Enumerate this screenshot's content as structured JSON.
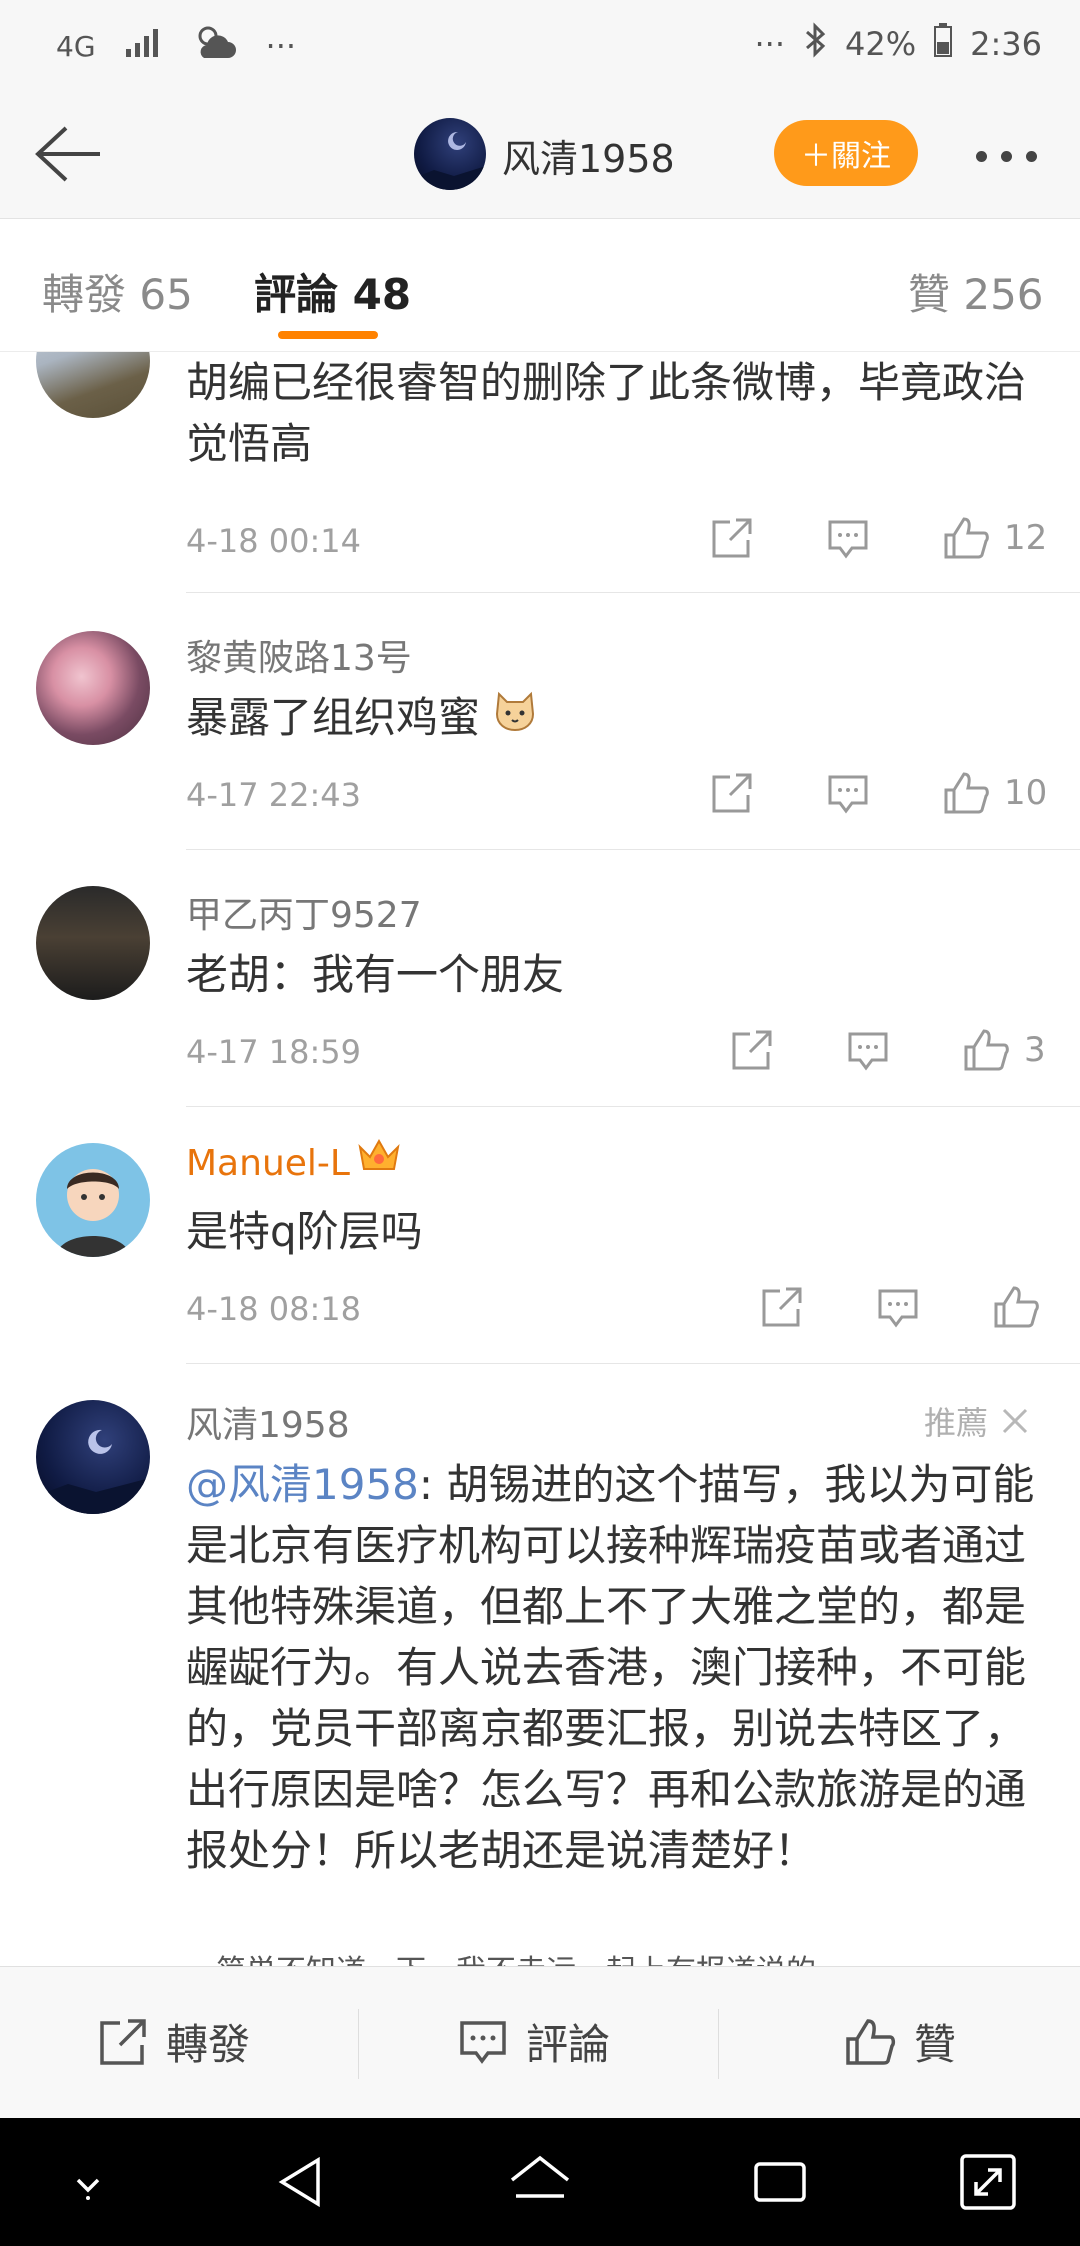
{
  "status": {
    "network": "4G",
    "battery": "42%",
    "time": "2:36",
    "dots": "···"
  },
  "header": {
    "title": "风清1958",
    "follow_label": "＋關注"
  },
  "tabs": [
    {
      "label": "轉發 65"
    },
    {
      "label": "評論 48"
    },
    {
      "label": "贊 256"
    }
  ],
  "comments": [
    {
      "name": "",
      "text": "胡编已经很睿智的删除了此条微博，毕竟政治觉悟高",
      "time": "4-18 00:14",
      "likes": "12"
    },
    {
      "name": "黎黄陂路13号",
      "text": "暴露了组织鸡蜜",
      "time": "4-17 22:43",
      "likes": "10"
    },
    {
      "name": "甲乙丙丁9527",
      "text": "老胡：我有一个朋友",
      "time": "4-17 18:59",
      "likes": "3"
    },
    {
      "name": "Manuel-L",
      "text": "是特q阶层吗",
      "time": "4-18 08:18",
      "likes": ""
    },
    {
      "name": "风清1958",
      "recommend": "推薦",
      "mention": "@风清1958",
      "text": ": 胡锡进的这个描写，我以为可能是北京有医疗机构可以接种辉瑞疫苗或者通过其他特殊渠道，但都上不了大雅之堂的，都是龌龊行为。有人说去香港，澳门接种，不可能的，党员干部离京都要汇报，别说去特区了，出行原因是啥？怎么写？再和公款旅游是的通报处分！所以老胡还是说清楚好！",
      "cut_line": "…简単不知道…下…我不走运…起上有报道说的"
    }
  ],
  "bottom": {
    "repost": "轉發",
    "comment": "評論",
    "like": "贊"
  },
  "colors": {
    "accent": "#ff8200",
    "follow": "#ff9a1a",
    "vip_name": "#e8740c",
    "mention": "#5b84c4"
  }
}
